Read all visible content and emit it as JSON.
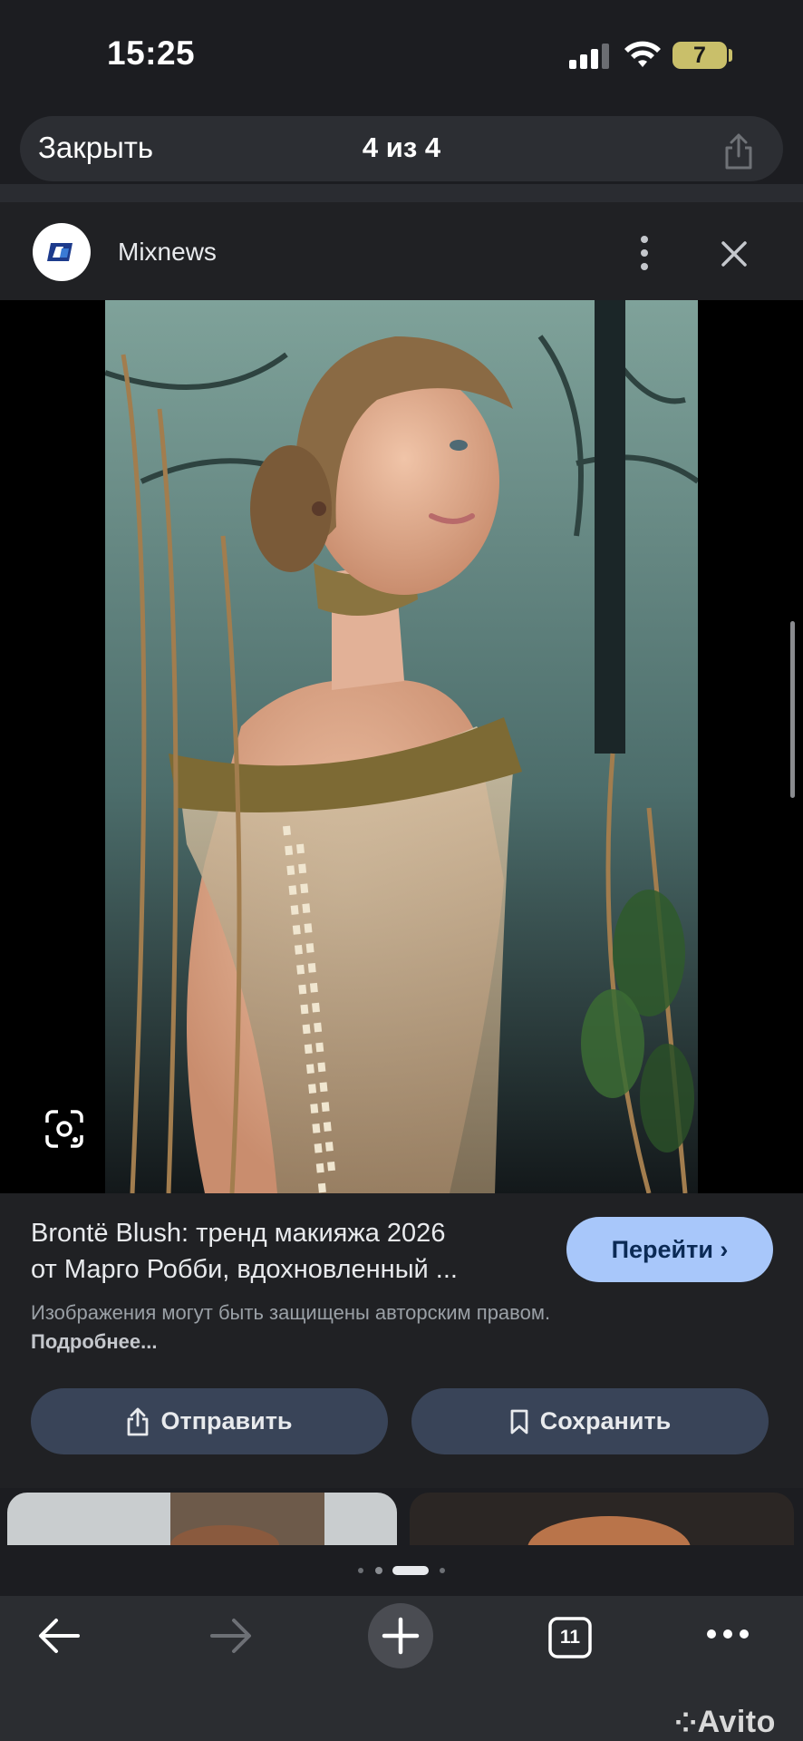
{
  "status_bar": {
    "time": "15:25",
    "battery_level": "7"
  },
  "viewer_bar": {
    "close_label": "Закрыть",
    "counter": "4 из 4"
  },
  "source": {
    "name": "Mixnews"
  },
  "result": {
    "title_line1": "Brontë Blush: тренд макияжа 2026",
    "title_line2": "от Марго Робби, вдохновленный ...",
    "visit_label": "Перейти ›",
    "copyright_text": "Изображения могут быть защищены авторским правом.",
    "more_link": "Подробнее...",
    "send_label": "Отправить",
    "save_label": "Сохранить"
  },
  "pager": {
    "dot_count": 4,
    "active_index": 2
  },
  "toolbar": {
    "tab_count": "11"
  },
  "watermark": "Avito",
  "colors": {
    "background": "#1c1d21",
    "panel": "#202124",
    "accent_button": "#a8c7fa",
    "action_button": "#394458",
    "battery": "#c9bf6a"
  }
}
